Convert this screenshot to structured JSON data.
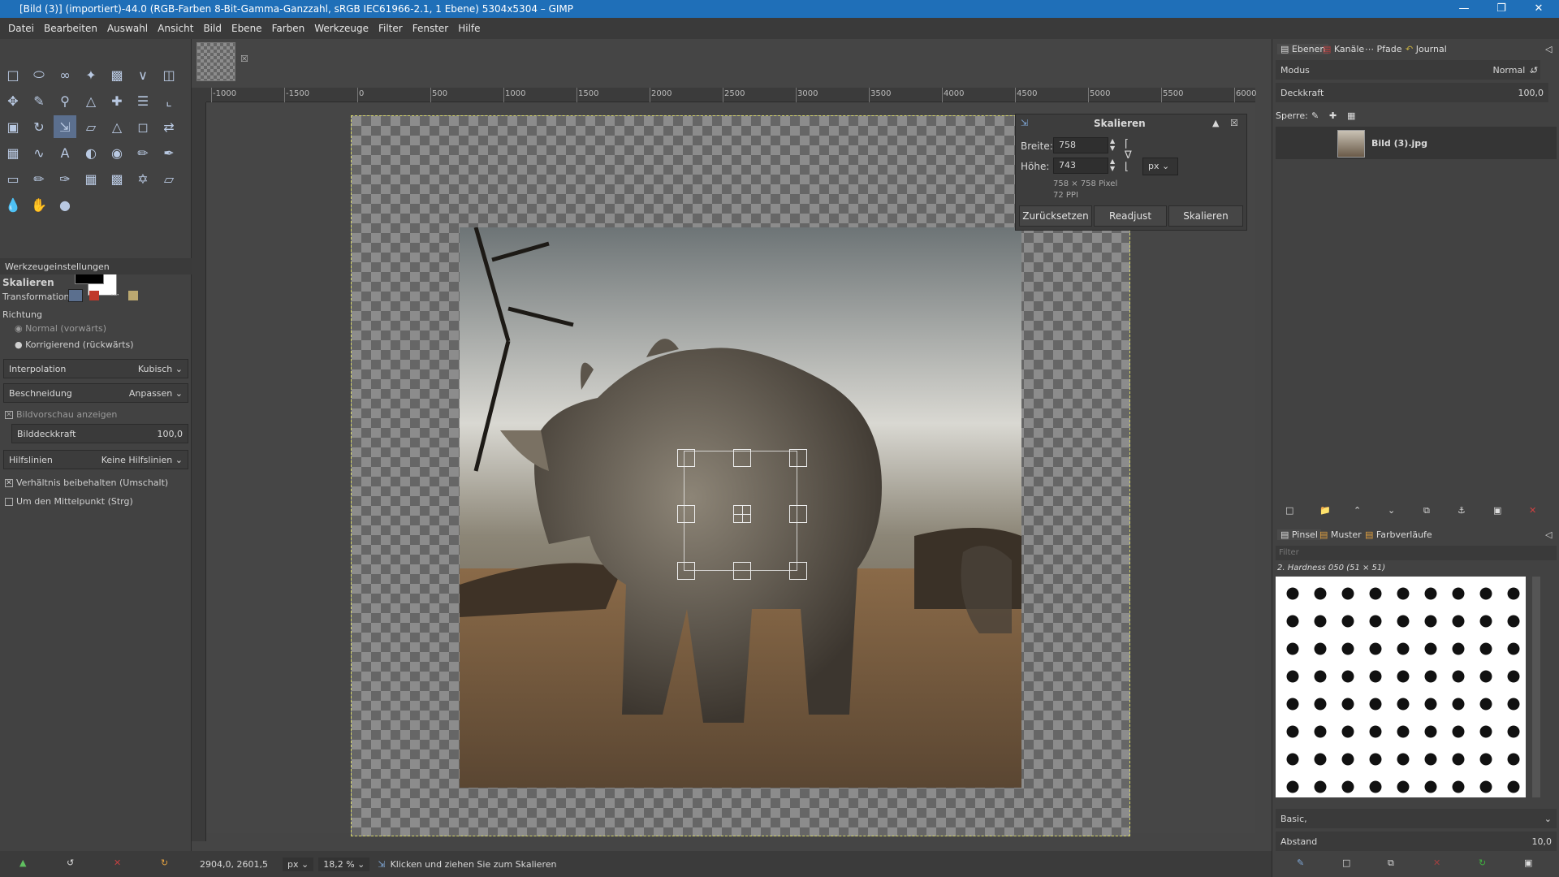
{
  "window": {
    "title": "[Bild (3)] (importiert)-44.0 (RGB-Farben 8-Bit-Gamma-Ganzzahl, sRGB IEC61966-2.1, 1 Ebene) 5304x5304 – GIMP"
  },
  "menu": [
    "Datei",
    "Bearbeiten",
    "Auswahl",
    "Ansicht",
    "Bild",
    "Ebene",
    "Farben",
    "Werkzeuge",
    "Filter",
    "Fenster",
    "Hilfe"
  ],
  "tool_options": {
    "header": "Werkzeugeinstellungen",
    "tool_name": "Skalieren",
    "transformation_label": "Transformation:",
    "direction_label": "Richtung",
    "direction_normal": "Normal (vorwärts)",
    "direction_corrective": "Korrigierend (rückwärts)",
    "interpolation_label": "Interpolation",
    "interpolation_value": "Kubisch",
    "clipping_label": "Beschneidung",
    "clipping_value": "Anpassen",
    "show_preview": "Bildvorschau anzeigen",
    "image_opacity_label": "Bilddeckkraft",
    "image_opacity_value": "100,0",
    "guides_label": "Hilfslinien",
    "guides_value": "Keine Hilfslinien",
    "keep_aspect": "Verhältnis beibehalten (Umschalt)",
    "around_center": "Um den Mittelpunkt (Strg)"
  },
  "ruler": {
    "h": [
      "1000",
      "1500",
      "0",
      "500",
      "1000",
      "1500",
      "2000",
      "2500",
      "3000",
      "3500",
      "4000",
      "4500",
      "5000",
      "5500",
      "6000"
    ],
    "h_neg": [
      true,
      true,
      false,
      false,
      false,
      false,
      false,
      false,
      false,
      false,
      false,
      false,
      false,
      false,
      false
    ]
  },
  "scale_dialog": {
    "title": "Skalieren",
    "width_label": "Breite:",
    "width_value": "758",
    "height_label": "Höhe:",
    "height_value": "743",
    "unit": "px",
    "pixel_info": "758 × 758 Pixel",
    "ppi": "72 PPI",
    "reset": "Zurücksetzen",
    "readjust": "Readjust",
    "scale": "Skalieren"
  },
  "layers_panel": {
    "tabs": [
      "Ebenen",
      "Kanäle",
      "Pfade",
      "Journal"
    ],
    "mode_label": "Modus",
    "mode_value": "Normal",
    "opacity_label": "Deckkraft",
    "opacity_value": "100,0",
    "lock_label": "Sperre:",
    "layer_name": "Bild (3).jpg"
  },
  "brushes_panel": {
    "tabs": [
      "Pinsel",
      "Muster",
      "Farbverläufe"
    ],
    "filter_placeholder": "Filter",
    "brush_name": "2. Hardness 050 (51 × 51)",
    "preset": "Basic,",
    "spacing_label": "Abstand",
    "spacing_value": "10,0"
  },
  "status": {
    "coords": "2904,0, 2601,5",
    "unit": "px",
    "zoom": "18,2 %",
    "message": "Klicken und ziehen Sie zum Skalieren"
  },
  "colors": {
    "accent": "#1f6fb8",
    "fg": "#000000",
    "bg": "#ffffff"
  }
}
